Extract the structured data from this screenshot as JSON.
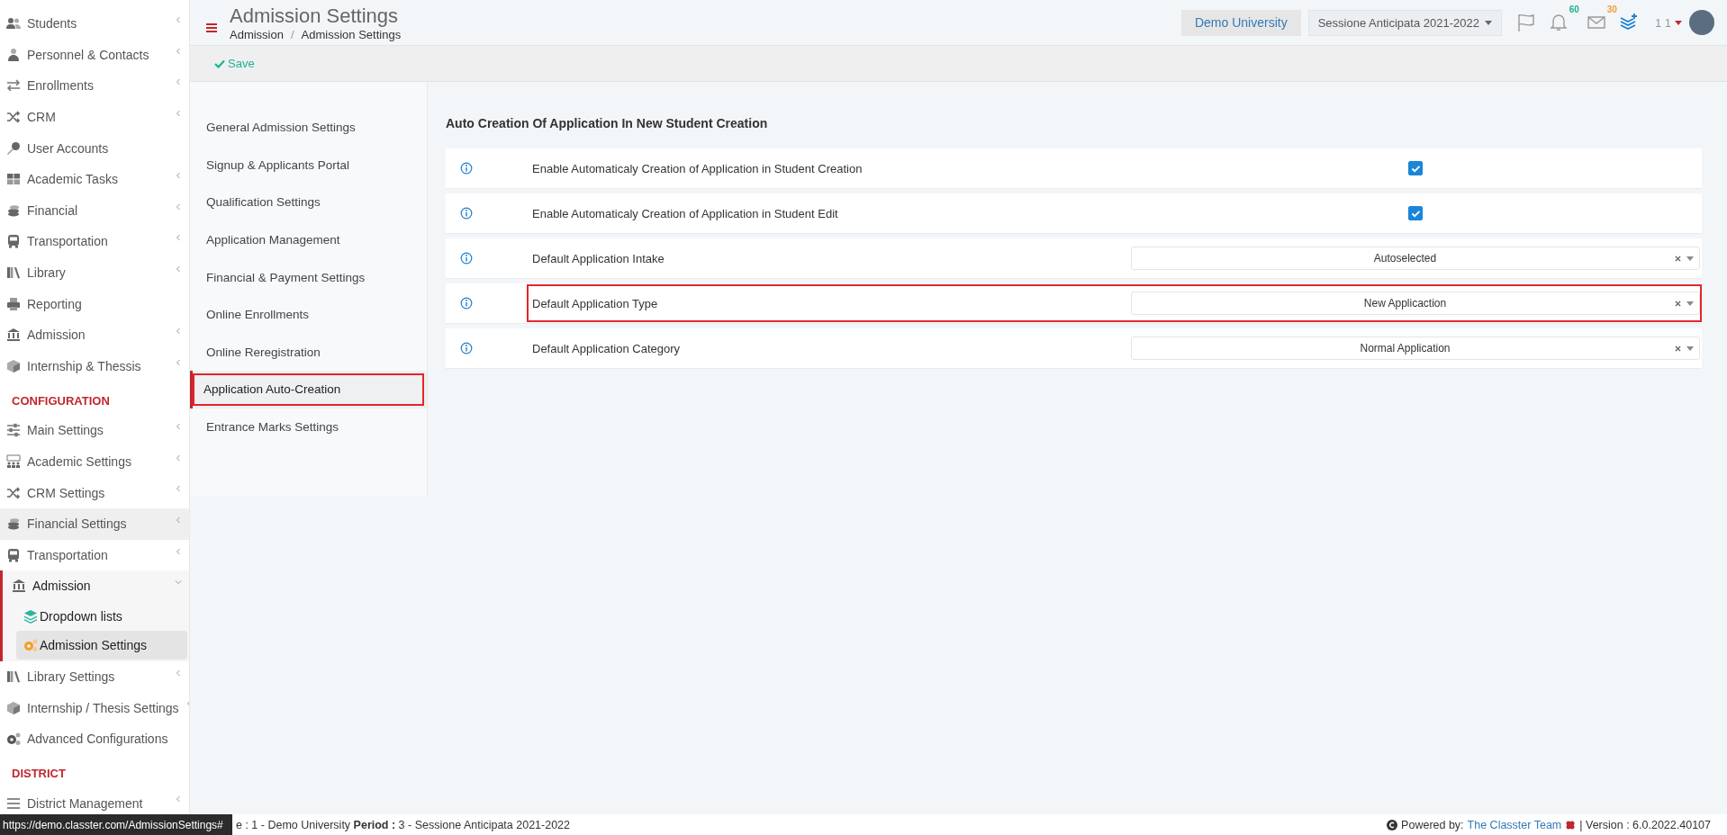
{
  "sidebar": {
    "sections": [
      {
        "items": [
          {
            "label": "Students",
            "expandable": true,
            "expanded": false,
            "hovered": false,
            "selected": false
          },
          {
            "label": "Personnel & Contacts",
            "expandable": true,
            "expanded": false,
            "hovered": false,
            "selected": false
          },
          {
            "label": "Enrollments",
            "expandable": true,
            "expanded": false,
            "hovered": false,
            "selected": false
          },
          {
            "label": "CRM",
            "expandable": true,
            "expanded": false,
            "hovered": false,
            "selected": false
          },
          {
            "label": "User Accounts",
            "expandable": false,
            "expanded": false,
            "hovered": false,
            "selected": false
          },
          {
            "label": "Academic Tasks",
            "expandable": true,
            "expanded": false,
            "hovered": false,
            "selected": false
          },
          {
            "label": "Financial",
            "expandable": true,
            "expanded": false,
            "hovered": false,
            "selected": false
          },
          {
            "label": "Transportation",
            "expandable": true,
            "expanded": false,
            "hovered": false,
            "selected": false
          },
          {
            "label": "Library",
            "expandable": true,
            "expanded": false,
            "hovered": false,
            "selected": false
          },
          {
            "label": "Reporting",
            "expandable": false,
            "expanded": false,
            "hovered": false,
            "selected": false
          },
          {
            "label": "Admission",
            "expandable": true,
            "expanded": false,
            "hovered": false,
            "selected": false
          },
          {
            "label": "Internship & Thessis",
            "expandable": true,
            "expanded": false,
            "hovered": false,
            "selected": false
          }
        ]
      },
      {
        "heading": "CONFIGURATION",
        "items": [
          {
            "label": "Main Settings",
            "expandable": true,
            "expanded": false,
            "hovered": false,
            "selected": false
          },
          {
            "label": "Academic Settings",
            "expandable": true,
            "expanded": false,
            "hovered": false,
            "selected": false
          },
          {
            "label": "CRM Settings",
            "expandable": true,
            "expanded": false,
            "hovered": false,
            "selected": false
          },
          {
            "label": "Financial Settings",
            "expandable": true,
            "expanded": false,
            "hovered": true,
            "selected": false
          },
          {
            "label": "Transportation",
            "expandable": true,
            "expanded": false,
            "hovered": false,
            "selected": false
          },
          {
            "label": "Admission",
            "expandable": true,
            "expanded": true,
            "hovered": false,
            "selected": false,
            "children": [
              {
                "label": "Dropdown lists",
                "selected": false
              },
              {
                "label": "Admission Settings",
                "selected": true
              }
            ]
          },
          {
            "label": "Library Settings",
            "expandable": true,
            "expanded": false,
            "hovered": false,
            "selected": false
          },
          {
            "label": "Internship / Thesis Settings",
            "expandable": true,
            "expanded": false,
            "hovered": false,
            "selected": false
          },
          {
            "label": "Advanced Configurations",
            "expandable": false,
            "expanded": false,
            "hovered": false,
            "selected": false
          }
        ]
      },
      {
        "heading": "DISTRICT",
        "items": [
          {
            "label": "District Management",
            "expandable": true,
            "expanded": false,
            "hovered": false,
            "selected": false
          }
        ]
      }
    ]
  },
  "header": {
    "title": "Admission Settings",
    "breadcrumb": [
      "Admission",
      "Admission Settings"
    ],
    "breadcrumb_separator": "/",
    "university": "Demo University",
    "session": "Sessione Anticipata 2021-2022",
    "notifications_badge": "60",
    "messages_badge": "30",
    "user": "1 1"
  },
  "toolbar": {
    "save": "Save"
  },
  "settings_nav": [
    {
      "label": "General Admission Settings",
      "selected": false,
      "highlighted": false
    },
    {
      "label": "Signup & Applicants Portal",
      "selected": false,
      "highlighted": false
    },
    {
      "label": "Qualification Settings",
      "selected": false,
      "highlighted": false
    },
    {
      "label": "Application Management",
      "selected": false,
      "highlighted": false
    },
    {
      "label": "Financial & Payment Settings",
      "selected": false,
      "highlighted": false
    },
    {
      "label": "Online Enrollments",
      "selected": false,
      "highlighted": false
    },
    {
      "label": "Online Reregistration",
      "selected": false,
      "highlighted": false
    },
    {
      "label": "Application Auto-Creation",
      "selected": true,
      "highlighted": true
    },
    {
      "label": "Entrance Marks Settings",
      "selected": false,
      "highlighted": false
    }
  ],
  "panel": {
    "title": "Auto Creation Of Application In New Student Creation",
    "rows": [
      {
        "label": "Enable Automaticaly Creation of Application in Student Creation",
        "kind": "checkbox",
        "checked": true,
        "highlighted": false
      },
      {
        "label": "Enable Automaticaly Creation of Application in Student Edit",
        "kind": "checkbox",
        "checked": true,
        "highlighted": false
      },
      {
        "label": "Default Application Intake",
        "kind": "select",
        "value": "Autoselected",
        "highlighted": false
      },
      {
        "label": "Default Application Type",
        "kind": "select",
        "value": "New Applicaction",
        "highlighted": true
      },
      {
        "label": "Default Application Category",
        "kind": "select",
        "value": "Normal Application",
        "highlighted": false
      }
    ]
  },
  "footer": {
    "info": "e : 1 - Demo University **Period :** 3 - Sessione Anticipata 2021-2022",
    "powered_by": "Powered by:",
    "team_link": "The Classter Team",
    "version": "| Version : 6.0.2022.40107"
  },
  "status_tooltip": "https://demo.classter.com/AdmissionSettings#"
}
